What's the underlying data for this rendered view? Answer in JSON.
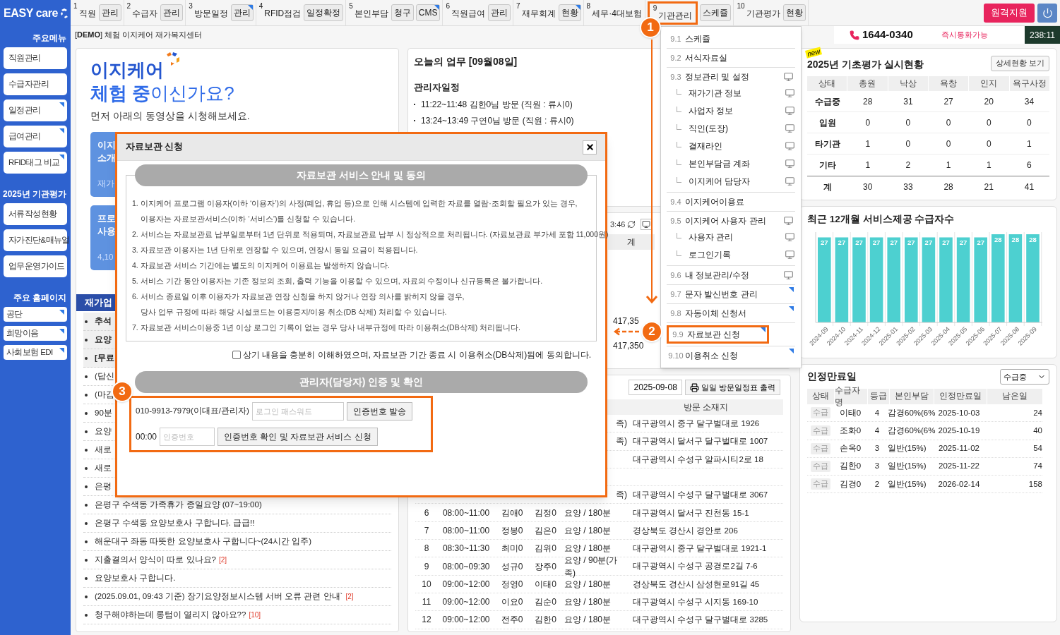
{
  "logo": "EASY care",
  "nav": {
    "groups": [
      {
        "number": "1",
        "label": "직원",
        "selected": false,
        "buttons": [
          {
            "label": "관리",
            "corner": false
          }
        ]
      },
      {
        "number": "2",
        "label": "수급자",
        "selected": false,
        "buttons": [
          {
            "label": "관리",
            "corner": false
          }
        ]
      },
      {
        "number": "3",
        "label": "방문일정",
        "selected": false,
        "buttons": [
          {
            "label": "관리",
            "corner": true
          }
        ]
      },
      {
        "number": "4",
        "label": "RFID점검",
        "selected": false,
        "buttons": [
          {
            "label": "일정확정",
            "corner": false
          }
        ]
      },
      {
        "number": "5",
        "label": "본인부담",
        "selected": false,
        "buttons": [
          {
            "label": "청구",
            "corner": false
          },
          {
            "label": "CMS",
            "corner": true
          }
        ]
      },
      {
        "number": "6",
        "label": "직원급여",
        "selected": false,
        "buttons": [
          {
            "label": "관리",
            "corner": false
          }
        ]
      },
      {
        "number": "7",
        "label": "재무회계",
        "selected": false,
        "buttons": [
          {
            "label": "현황",
            "corner": true
          }
        ]
      },
      {
        "number": "8",
        "label": "세무·4대보험",
        "selected": false
      },
      {
        "number": "9",
        "label": "기관관리",
        "selected": true,
        "buttons": [
          {
            "label": "스케쥴",
            "corner": false
          }
        ]
      },
      {
        "number": "10",
        "label": "기관평가",
        "selected": false,
        "buttons": [
          {
            "label": "현황",
            "corner": false
          }
        ]
      }
    ],
    "remote_button": "원격지원"
  },
  "subheader": {
    "center": "[**DEMO**] 체험 이지케어 재가복지센터",
    "phone": "1644-0340",
    "phone_note": "즉시통화가능",
    "timer": "238:11"
  },
  "sidebar": {
    "sections": [
      {
        "title": "주요메뉴",
        "kind": "menu",
        "items": [
          {
            "label": "직원관리",
            "corner": false
          },
          {
            "label": "수급자관리",
            "corner": false
          },
          {
            "label": "일정관리",
            "corner": true
          },
          {
            "label": "급여관리",
            "corner": true
          },
          {
            "label": "RFID태그 비교",
            "corner": true
          }
        ]
      },
      {
        "title": "2025년 기관평가",
        "kind": "menu",
        "items": [
          {
            "label": "서류작성현황",
            "corner": false
          },
          {
            "label": "자가진단&매뉴얼",
            "corner": false
          },
          {
            "label": "업무운영가이드",
            "corner": false
          }
        ]
      },
      {
        "title": "주요 홈페이지",
        "kind": "link",
        "items": [
          {
            "label": "공단",
            "corner": true
          },
          {
            "label": "희망이음",
            "corner": true
          },
          {
            "label": "사회보험 EDI",
            "corner": true
          }
        ]
      }
    ]
  },
  "intro": {
    "brand": "이지케어",
    "headline": "**체험 중**이신가요?",
    "subtitle": "먼저 아래의 동영상을 시청해보세요.",
    "cards": [
      {
        "line1": "이지",
        "line2": "소개",
        "footer": "재가"
      },
      {
        "line1": "프로",
        "line2": "사용",
        "footer": "4,10"
      }
    ]
  },
  "board": {
    "title": "재가업",
    "posts": [
      {
        "text": "추석",
        "notice": true
      },
      {
        "text": "요양",
        "notice": true
      },
      {
        "text": "[무료",
        "notice": true
      },
      {
        "text": "(답신",
        "notice": false
      },
      {
        "text": "(마감",
        "notice": false
      },
      {
        "text": "90분",
        "notice": false
      },
      {
        "text": "요양",
        "notice": false
      },
      {
        "text": "새로",
        "notice": false
      },
      {
        "text": "새로",
        "notice": false
      },
      {
        "text": "은평",
        "notice": false
      },
      {
        "text": "은평구 수색동 가족휴가 종일요양 (07~19:00)",
        "notice": false
      },
      {
        "text": "은평구 수색동 요양보호사 구합니다. 급급!!",
        "notice": false
      },
      {
        "text": "해운대구 좌동 따뜻한 요양보호사 구합니다~(24시간 입주)",
        "notice": false
      },
      {
        "text": "지출결의서 양식이 따로 있나요?",
        "count": "[2]",
        "notice": false
      },
      {
        "text": "요양보호사 구합니다.",
        "notice": false
      },
      {
        "text": "(2025.09.01, 09:43 기준) 장기요양정보시스템 서버 오류 관련 안내`",
        "count": "[2]",
        "notice": false
      },
      {
        "text": "청구해야하는데 롱텀이 열리지 않아요??",
        "count": "[10]",
        "notice": false
      }
    ]
  },
  "today": {
    "title": "오늘의 업무 [09월08일]",
    "section": "관리자일정",
    "items": [
      "11:22~11:48 김한0님 방문 (직원 : 류시0)",
      "13:24~13:49 구연0님 방문 (직원 : 류시0)"
    ]
  },
  "summary": {
    "time": "3:46",
    "total_header": "계",
    "values": [
      "417,35",
      "417,350"
    ]
  },
  "visits": {
    "date": "2025-09-08",
    "print_button": "일일 방문일정표 출력",
    "address_header": "방문 소재지",
    "rows": [
      {
        "service": "족)",
        "address": "대구광역시 중구 달구벌대로 1926"
      },
      {
        "service": "족)",
        "address": "대구광역시 달서구 달구벌대로 1007"
      },
      {
        "address": "대구광역시 수성구 알파시티2로 18"
      },
      {},
      {
        "service": "족)",
        "address": "대구광역시 수성구 달구벌대로 3067"
      },
      {
        "no": "6",
        "time": "08:00~11:00",
        "staff": "김애0",
        "client": "김정0",
        "service": "요양 / 180분",
        "address": "대구광역시 달서구 진천동 15-1"
      },
      {
        "no": "7",
        "time": "08:00~11:00",
        "staff": "정봉0",
        "client": "김은0",
        "service": "요양 / 180분",
        "address": "경상북도 경산시 경안로 206"
      },
      {
        "no": "8",
        "time": "08:30~11:30",
        "staff": "최미0",
        "client": "김위0",
        "service": "요양 / 180분",
        "address": "대구광역시 중구 달구벌대로 1921-1"
      },
      {
        "no": "9",
        "time": "08:00~09:30",
        "staff": "성규0",
        "client": "장주0",
        "service": "요양 / 90분(가족)",
        "address": "대구광역시 수성구 공경로2길 7-6"
      },
      {
        "no": "10",
        "time": "09:00~12:00",
        "staff": "정영0",
        "client": "이태0",
        "service": "요양 / 180분",
        "address": "경상북도 경산시 삼성현로91길 45"
      },
      {
        "no": "11",
        "time": "09:00~12:00",
        "staff": "이요0",
        "client": "김순0",
        "service": "요양 / 180분",
        "address": "대구광역시 수성구 시지동 169-10"
      },
      {
        "no": "12",
        "time": "09:00~12:00",
        "staff": "전주0",
        "client": "김한0",
        "service": "요양 / 180분",
        "address": "대구광역시 수성구 달구벌대로 3285"
      }
    ]
  },
  "menu": {
    "items": [
      {
        "number": "9.1",
        "label": "스케쥴",
        "kind": "plain",
        "highlighted": false
      },
      {
        "number": "9.2",
        "label": "서식자료실",
        "kind": "plain",
        "highlighted": false
      },
      {
        "number": "9.3",
        "label": "정보관리 및 설정",
        "kind": "popup",
        "highlighted": false,
        "children": [
          {
            "label": "재가기관 정보"
          },
          {
            "label": "사업자 정보"
          },
          {
            "label": "직인(도장)"
          },
          {
            "label": "결재라인"
          },
          {
            "label": "본인부담금 계좌"
          },
          {
            "label": "이지케어 담당자"
          }
        ]
      },
      {
        "number": "9.4",
        "label": "이지케어이용료",
        "kind": "plain",
        "highlighted": false
      },
      {
        "number": "9.5",
        "label": "이지케어 사용자 관리",
        "kind": "popup",
        "highlighted": false,
        "children": [
          {
            "label": "사용자 관리"
          },
          {
            "label": "로그인기록"
          }
        ]
      },
      {
        "number": "9.6",
        "label": "내 정보관리/수정",
        "kind": "popup",
        "highlighted": false
      },
      {
        "number": "9.7",
        "label": "문자 발신번호 관리",
        "kind": "submenu",
        "highlighted": false
      },
      {
        "number": "9.8",
        "label": "자동이체 신청서",
        "kind": "submenu",
        "highlighted": false
      },
      {
        "number": "9.9",
        "label": "자료보관 신청",
        "kind": "submenu",
        "highlighted": true
      },
      {
        "number": "9.10",
        "label": "이용취소 신청",
        "kind": "submenu",
        "highlighted": false
      }
    ]
  },
  "evaluation": {
    "badge": "new",
    "title": "2025년 기초평가 실시현황",
    "detail_button": "상세현황 보기",
    "columns": [
      "상태",
      "총원",
      "낙상",
      "욕창",
      "인지",
      "욕구사정"
    ],
    "rows": [
      {
        "label": "수급중",
        "values": [
          "28",
          "31",
          "27",
          "20",
          "34"
        ]
      },
      {
        "label": "입원",
        "values": [
          "0",
          "0",
          "0",
          "0",
          "0"
        ]
      },
      {
        "label": "타기관",
        "values": [
          "1",
          "0",
          "0",
          "0",
          "1"
        ]
      },
      {
        "label": "기타",
        "values": [
          "1",
          "2",
          "1",
          "1",
          "6"
        ]
      }
    ],
    "total": {
      "label": "계",
      "values": [
        "30",
        "33",
        "28",
        "21",
        "41"
      ]
    }
  },
  "service_chart": {
    "title": "최근 12개월 서비스제공 수급자수",
    "chart_data": {
      "type": "bar",
      "categories": [
        "2024-09",
        "2024-10",
        "2024-11",
        "2024-12",
        "2025-01",
        "2025-02",
        "2025-03",
        "2025-04",
        "2025-05",
        "2025-06",
        "2025-07",
        "2025-08",
        "2025-09"
      ],
      "series": [
        {
          "color": "#4dd0d0",
          "values": [
            27,
            27,
            27,
            27,
            27,
            27,
            27,
            27,
            27,
            27,
            28,
            28,
            28
          ]
        }
      ],
      "data_labels": true
    }
  },
  "expiry": {
    "title": "인정만료일",
    "filter": "수급중",
    "columns": [
      "상태",
      "수급자명",
      "등급",
      "본인부담",
      "인정만료일",
      "남은일"
    ],
    "rows": [
      {
        "status": "수급",
        "name": "이태0",
        "grade": "4",
        "copay": "감경60%(6%",
        "date": "2025-10-03",
        "days": "24"
      },
      {
        "status": "수급",
        "name": "조화0",
        "grade": "4",
        "copay": "감경60%(6%",
        "date": "2025-10-19",
        "days": "40"
      },
      {
        "status": "수급",
        "name": "손옥0",
        "grade": "3",
        "copay": "일반(15%)",
        "date": "2025-11-02",
        "days": "54"
      },
      {
        "status": "수급",
        "name": "김한0",
        "grade": "3",
        "copay": "일반(15%)",
        "date": "2025-11-22",
        "days": "74"
      },
      {
        "status": "수급",
        "name": "김경0",
        "grade": "2",
        "copay": "일반(15%)",
        "date": "2026-02-14",
        "days": "158"
      }
    ]
  },
  "dialog": {
    "title": "자료보관 신청",
    "notice_header": "자료보관 서비스 안내 및 동의",
    "terms": [
      {
        "lines": [
          "1. 이지케어 프로그램 이용자(이하 ‘이용자’)의 사정(폐업, 휴업 등)으로 인해 시스템에 입력한 자료를 열람·조회할 필요가 있는 경우,",
          "이용자는 자료보관서비스(이하 ‘서비스’)를 신청할 수 있습니다."
        ]
      },
      {
        "lines": [
          "2. 서비스는 자료보관료 납부일로부터 1년 단위로 적용되며, 자료보관료 납부 시 정상적으로 처리됩니다. (자료보관료 부가세 포함 11,000원)"
        ]
      },
      {
        "lines": [
          "3. 자료보관 이용자는 1년 단위로 연장할 수 있으며, 연장시 동일 요금이 적용됩니다."
        ]
      },
      {
        "lines": [
          "4. 자료보관 서비스 기간에는 별도의 이지케어 이용료는 발생하지 않습니다."
        ]
      },
      {
        "lines": [
          "5. 서비스 기간 동안 이용자는 기존 정보의 조회, 출력 기능을 이용할 수 있으며, 자료의 수정이나 신규등록은 불가합니다."
        ]
      },
      {
        "lines": [
          "6. 서비스 종료일 이후 이용자가 자료보관 연장 신청을 하지 않거나 연장 의사를 밝히지 않을 경우,",
          "당사 업무 규정에 따라 해당 시설코드는 이용중지/이용 취소(DB 삭제) 처리할 수 있습니다."
        ]
      },
      {
        "lines": [
          "7. 자료보관 서비스이용중 1년 이상 로그인 기록이 없는 경우 당사 내부규정에 따라 이용취소(DB삭제) 처리됩니다."
        ]
      }
    ],
    "agree": {
      "label": "상기 내용을 충분히 이해하였으며, 자료보관 기간 종료 시 이용취소(DB삭제)됨에 동의합니다.",
      "checked": false
    },
    "auth_header": "관리자(담당자) 인증 및 확인",
    "auth": {
      "highlighted": true,
      "contact": "010-9913-7979(이대표/관리자)",
      "password_placeholder": "로그인 패스워드",
      "send_button": "인증번호 발송",
      "timer": "00:00",
      "code_placeholder": "인증번호",
      "confirm_button": "인증번호 확인 및 자료보관 서비스 신청"
    }
  },
  "annotations": [
    {
      "number": "1"
    },
    {
      "number": "2"
    },
    {
      "number": "3"
    }
  ]
}
